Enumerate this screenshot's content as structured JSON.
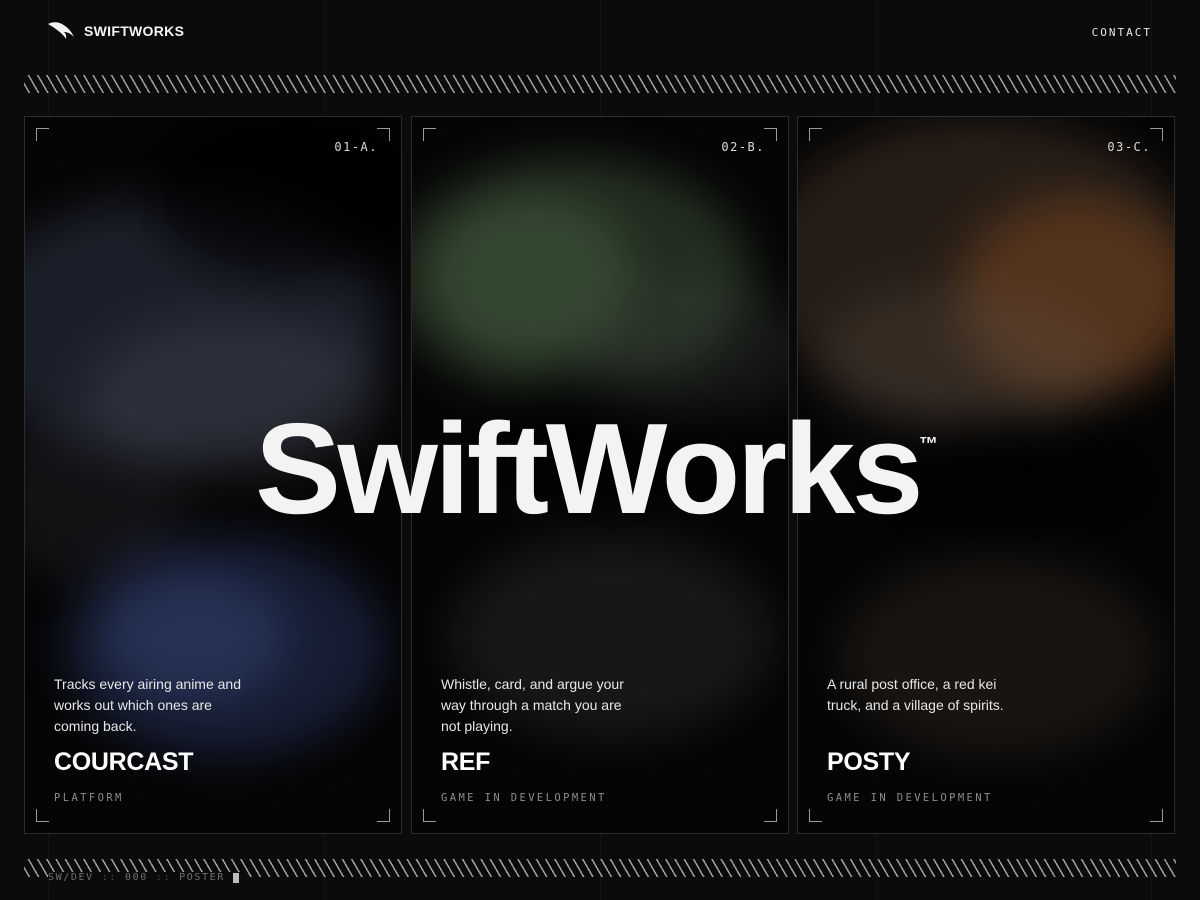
{
  "header": {
    "brand": "SWIFTWORKS",
    "contact_label": "CONTACT"
  },
  "hero": {
    "wordmark": "SwiftWorks",
    "trademark": "™"
  },
  "cards": [
    {
      "code": "01-A.",
      "description": "Tracks every airing anime and works out which ones are coming back.",
      "title": "COURCAST",
      "tag": "PLATFORM",
      "tint": "#2e3d66"
    },
    {
      "code": "02-B.",
      "description": "Whistle, card, and argue your way through a match you are not playing.",
      "title": "REF",
      "tag": "GAME IN DEVELOPMENT",
      "tint": "#3c5236"
    },
    {
      "code": "03-C.",
      "description": "A rural post office, a red kei truck, and a village of spirits.",
      "title": "POSTY",
      "tag": "GAME IN DEVELOPMENT",
      "tint": "#6a3c1c"
    }
  ],
  "footer": {
    "segment_1": "SW/DEV",
    "separator": "::",
    "segment_2": "000",
    "segment_3": "POSTER"
  }
}
